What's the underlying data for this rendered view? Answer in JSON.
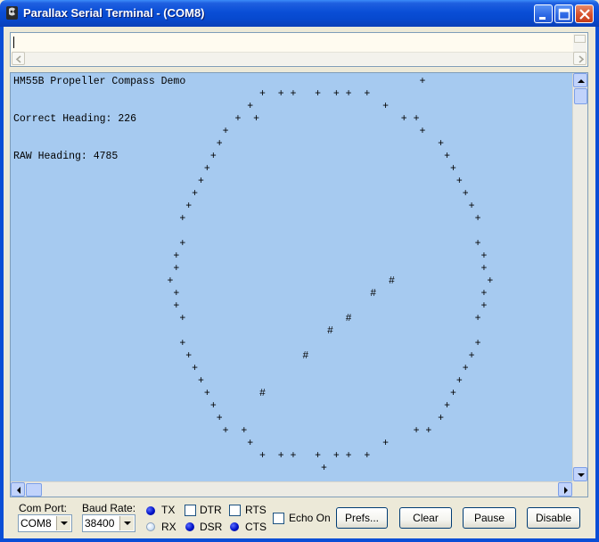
{
  "window": {
    "title": "Parallax Serial Terminal - (COM8)"
  },
  "transmit": {
    "value": ""
  },
  "receive": {
    "lines": [
      "HM55B Propeller Compass Demo                                      +",
      "                                        +  + +   +  + +  +",
      "                                      +                     +",
      "Correct Heading: 226                +  +                       + +",
      "                                  +                               +",
      "                                 +                                   +",
      "RAW Heading: 4785               +                                     +",
      "                               +                                       +",
      "                              +                                         +",
      "                             +                                           +",
      "                            +                                             +",
      "                           +                                               +",
      "",
      "                           +                                               +",
      "                          +                                                 +",
      "                          +                                                 +",
      "                         +                                   #               +",
      "                          +                               #                 +",
      "                          +                                                 +",
      "                           +                          #                    +",
      "                                                   #",
      "                           +                                               +",
      "                            +                  #                          +",
      "                             +                                           +",
      "                              +                                         +",
      "                               +        #                              +",
      "                                +                                     +",
      "                                 +                                   +",
      "                                  +  +                           + +",
      "                                      +                     +",
      "                                        +  + +   +  + +  +",
      "                                                  +"
    ]
  },
  "controls": {
    "com_port_label": "Com Port:",
    "com_port_value": "COM8",
    "baud_rate_label": "Baud Rate:",
    "baud_rate_value": "38400",
    "tx_label": "TX",
    "rx_label": "RX",
    "dtr_label": "DTR",
    "dsr_label": "DSR",
    "rts_label": "RTS",
    "cts_label": "CTS",
    "echo_label": "Echo On",
    "prefs_label": "Prefs...",
    "clear_label": "Clear",
    "pause_label": "Pause",
    "disable_label": "Disable"
  },
  "colors": {
    "receive_background": "#a6caf0",
    "led_on": "#0012c8",
    "led_off": "#d6e6f8"
  }
}
